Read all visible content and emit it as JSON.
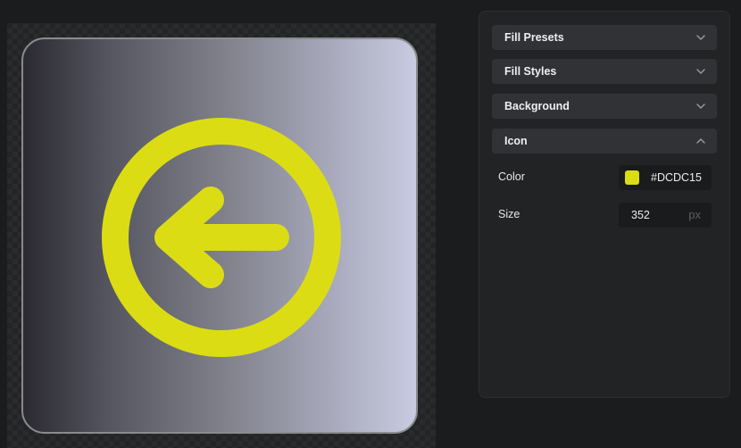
{
  "preview": {
    "icon": "circle-arrow-left-icon",
    "icon_color": "#DCDC15"
  },
  "panel": {
    "sections": {
      "fill_presets": {
        "label": "Fill Presets",
        "chevron": "chevron-down-icon"
      },
      "fill_styles": {
        "label": "Fill Styles",
        "chevron": "chevron-down-icon"
      },
      "background": {
        "label": "Background",
        "chevron": "chevron-down-icon"
      },
      "icon": {
        "label": "Icon",
        "chevron": "chevron-up-icon"
      }
    },
    "icon_settings": {
      "color_label": "Color",
      "color_hex": "#DCDC15",
      "size_label": "Size",
      "size_value": "352",
      "size_unit": "px"
    }
  }
}
